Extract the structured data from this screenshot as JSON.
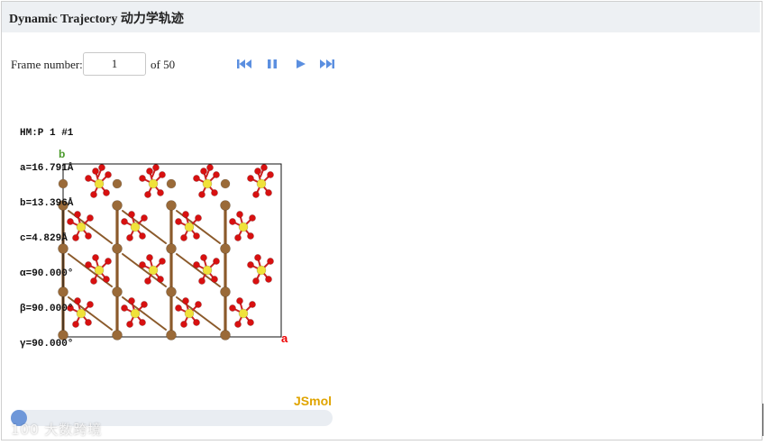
{
  "header": {
    "title": "Dynamic Trajectory 动力学轨迹"
  },
  "controls": {
    "frame_label": "Frame number:",
    "frame_value": "1",
    "of_text": "of 50",
    "buttons": [
      "first-frame",
      "pause",
      "play",
      "last-frame"
    ],
    "icon_color": "#5b8fe0"
  },
  "viewer": {
    "cell_info": [
      "HM:P 1 #1",
      "a=16.791Å",
      "b=13.396Å",
      "c=4.829Å",
      "α=90.000°",
      "β=90.000°",
      "γ=90.000°"
    ],
    "axis_a_label": "a",
    "axis_b_label": "b",
    "brand": "JSmol",
    "atom_colors": {
      "metal": "#9a6a38",
      "sulfur": "#f0e23a",
      "oxygen": "#d81010",
      "bond_metal": "#8b5a2b"
    }
  },
  "progress": {
    "fraction": 0.02
  },
  "watermark": {
    "text": "大数跨境",
    "logo_text": "100"
  }
}
